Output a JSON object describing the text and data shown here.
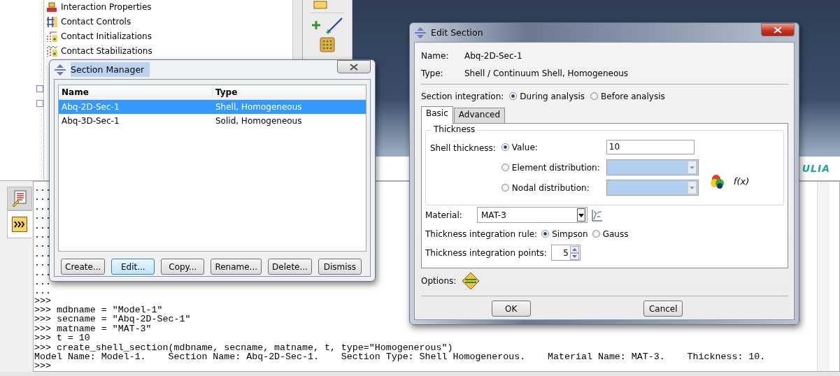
{
  "model_tree": {
    "items": [
      {
        "label": "Interaction Properties",
        "kind": "props"
      },
      {
        "label": "Contact Controls",
        "kind": "controls"
      },
      {
        "label": "Contact Initializations",
        "kind": "init"
      },
      {
        "label": "Contact Stabilizations",
        "kind": "stab"
      }
    ]
  },
  "viewport": {
    "logo_text": "ULIA"
  },
  "message_tabs": [
    {
      "kind": "messages",
      "selected": false
    },
    {
      "kind": "console",
      "selected": true
    }
  ],
  "console": {
    "lines": [
      "...",
      "...",
      "...",
      "...",
      "...",
      "...",
      "...",
      "...",
      "...",
      "...",
      "...",
      "...",
      ">>>",
      ">>> mdbname = \"Model-1\"",
      ">>> secname = \"Abq-2D-Sec-1\"",
      ">>> matname = \"MAT-3\"",
      ">>> t = 10",
      ">>> create_shell_section(mdbname, secname, matname, t, type=\"Homogenerous\")",
      "Model Name: Model-1.    Section Name: Abq-2D-Sec-1.    Section Type: Shell Homogenerous.    Material Name: MAT-3.    Thickness: 10.",
      ">>>"
    ]
  },
  "section_manager": {
    "title": "Section Manager",
    "columns": [
      "Name",
      "Type"
    ],
    "rows": [
      {
        "name": "Abq-2D-Sec-1",
        "type": "Shell, Homogeneous",
        "selected": true
      },
      {
        "name": "Abq-3D-Sec-1",
        "type": "Solid, Homogeneous",
        "selected": false
      }
    ],
    "buttons": [
      {
        "label": "Create...",
        "focused": false
      },
      {
        "label": "Edit...",
        "focused": true
      },
      {
        "label": "Copy...",
        "focused": false
      },
      {
        "label": "Rename...",
        "focused": false
      },
      {
        "label": "Delete...",
        "focused": false
      },
      {
        "label": "Dismiss",
        "focused": false
      }
    ]
  },
  "edit_section": {
    "title": "Edit Section",
    "name_label": "Name:",
    "name": "Abq-2D-Sec-1",
    "type_label": "Type:",
    "type": "Shell / Continuum Shell, Homogeneous",
    "integration": {
      "label": "Section integration:",
      "options": [
        {
          "label": "During analysis",
          "selected": true
        },
        {
          "label": "Before analysis",
          "selected": false
        }
      ]
    },
    "tabs": [
      {
        "label": "Basic",
        "selected": true
      },
      {
        "label": "Advanced",
        "selected": false
      }
    ],
    "thickness": {
      "title": "Thickness",
      "label": "Shell thickness:",
      "function_label": "f(x)",
      "options": [
        {
          "label": "Value:",
          "selected": true,
          "kind": "text",
          "value": "10"
        },
        {
          "label": "Element distribution:",
          "selected": false,
          "kind": "combo"
        },
        {
          "label": "Nodal distribution:",
          "selected": false,
          "kind": "combo"
        }
      ]
    },
    "material": {
      "label": "Material:",
      "value": "MAT-3"
    },
    "rule": {
      "label": "Thickness integration rule:",
      "options": [
        {
          "label": "Simpson",
          "selected": true
        },
        {
          "label": "Gauss",
          "selected": false
        }
      ]
    },
    "points": {
      "label": "Thickness integration points:",
      "value": "5"
    },
    "options_label": "Options:",
    "buttons": [
      "OK",
      "Cancel"
    ]
  }
}
